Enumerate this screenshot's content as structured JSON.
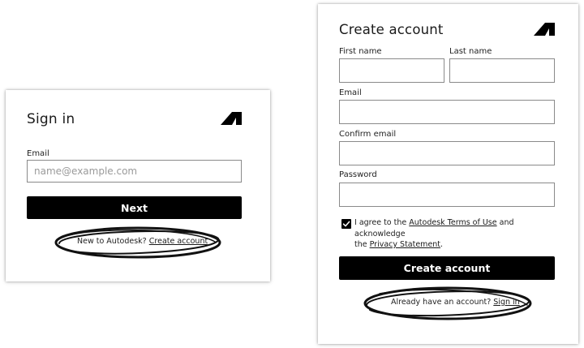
{
  "signin": {
    "title": "Sign in",
    "email_label": "Email",
    "email_placeholder": "name@example.com",
    "next_button": "Next",
    "footer_text": "New to Autodesk?",
    "footer_link": "Create account"
  },
  "create_account": {
    "title": "Create account",
    "first_name_label": "First name",
    "last_name_label": "Last name",
    "email_label": "Email",
    "confirm_email_label": "Confirm email",
    "password_label": "Password",
    "terms_prefix": "I agree to the",
    "terms_link": "Autodesk Terms of Use",
    "terms_middle": "and acknowledge",
    "terms_the": "the",
    "privacy_link": "Privacy Statement",
    "terms_end": ".",
    "agree_checked": true,
    "create_button": "Create account",
    "footer_text": "Already have an account?",
    "footer_link": "Sign in"
  },
  "icons": {
    "logo": "autodesk-logo-icon",
    "check": "checkmark-icon"
  },
  "colors": {
    "button": "#000000",
    "field_border": "#8a8a8a",
    "scribble": "#111111"
  }
}
